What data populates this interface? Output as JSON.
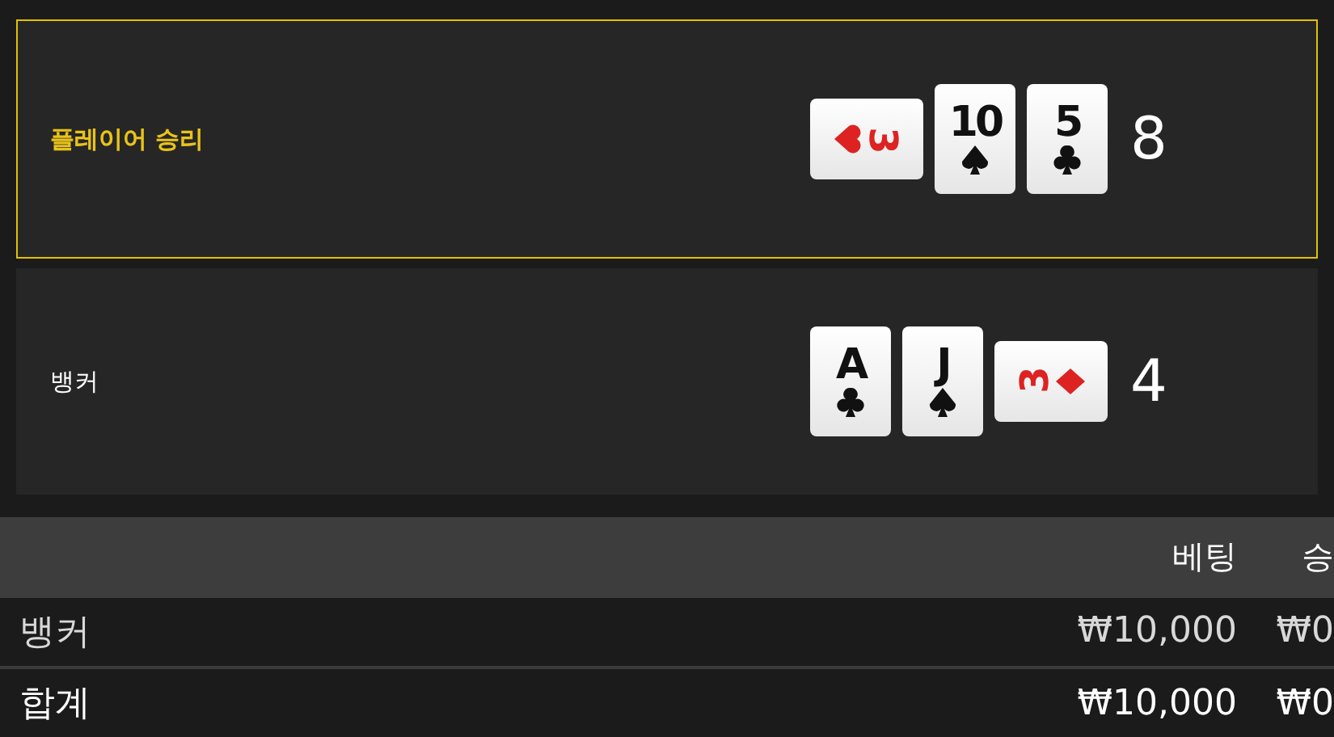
{
  "hands": [
    {
      "label": "플레이어 승리",
      "selected": true,
      "total": "8",
      "cards": [
        {
          "rank": "3",
          "kind": "hearts",
          "sideways": true,
          "reversed": false
        },
        {
          "rank": "10",
          "kind": "spades",
          "sideways": false,
          "reversed": false
        },
        {
          "rank": "5",
          "kind": "clubs",
          "sideways": false,
          "reversed": false
        }
      ]
    },
    {
      "label": "뱅커",
      "selected": false,
      "total": "4",
      "cards": [
        {
          "rank": "A",
          "kind": "clubs",
          "sideways": false,
          "reversed": false
        },
        {
          "rank": "J",
          "kind": "spades",
          "sideways": false,
          "reversed": false
        },
        {
          "rank": "3",
          "kind": "diamonds",
          "sideways": true,
          "reversed": true
        }
      ]
    }
  ],
  "table": {
    "columns": [
      "베팅",
      "승"
    ],
    "rows": [
      {
        "kind": "entry",
        "label": "뱅커",
        "bet": "₩10,000",
        "win": "₩0"
      },
      {
        "kind": "total",
        "label": "합계",
        "bet": "₩10,000",
        "win": "₩0"
      }
    ]
  }
}
